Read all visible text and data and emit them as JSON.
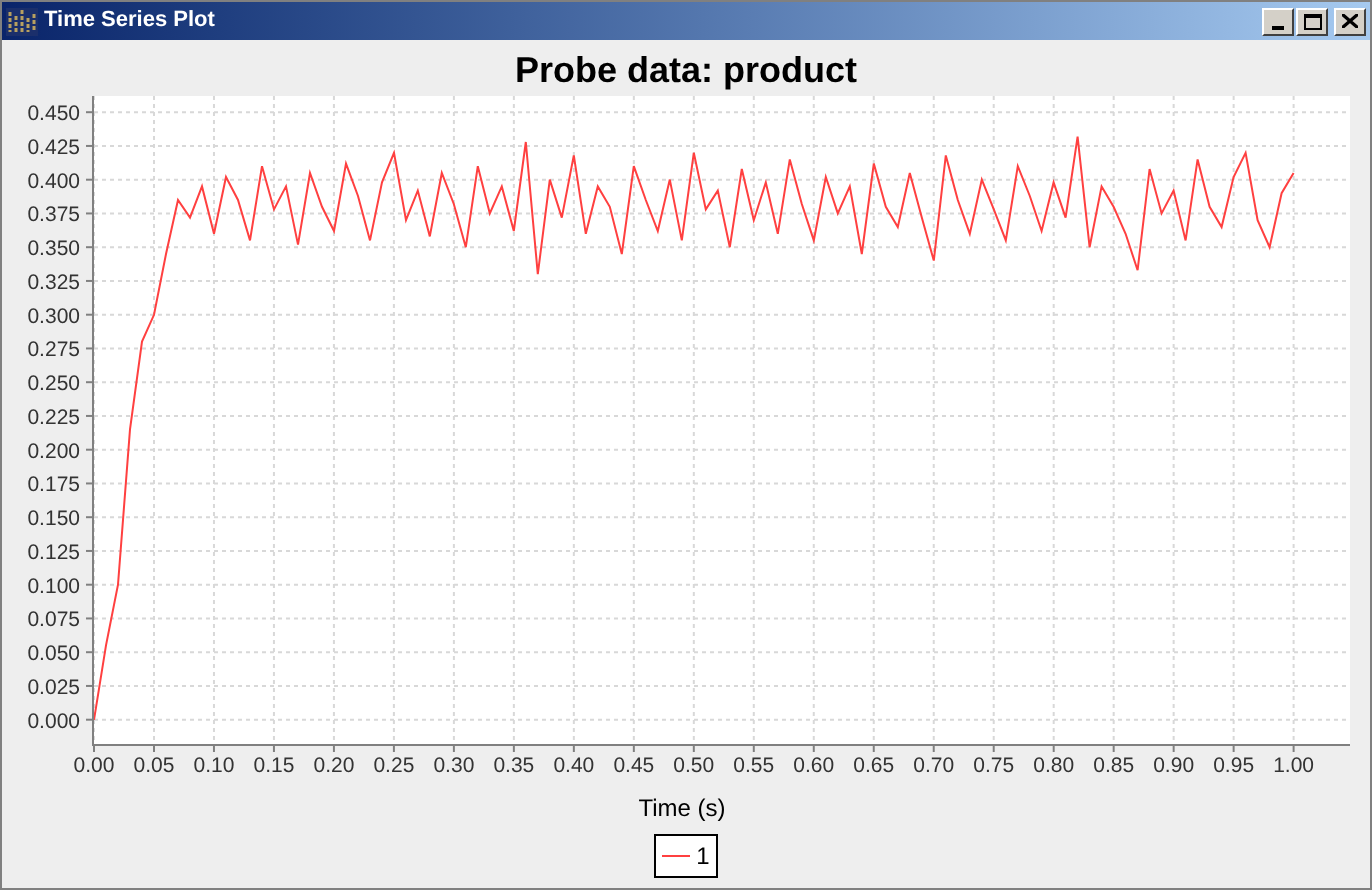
{
  "window": {
    "title": "Time Series Plot"
  },
  "chart": {
    "chart_data": {
      "type": "line",
      "grid": true,
      "title": "Probe data: product",
      "xlabel": "Time (s)",
      "x": [
        0,
        0.01,
        0.02,
        0.03,
        0.04,
        0.05,
        0.06,
        0.07,
        0.08,
        0.09,
        0.1,
        0.11,
        0.12,
        0.13,
        0.14,
        0.15,
        0.16,
        0.17,
        0.18,
        0.19,
        0.2,
        0.21,
        0.22,
        0.23,
        0.24,
        0.25,
        0.26,
        0.27,
        0.28,
        0.29,
        0.3,
        0.31,
        0.32,
        0.33,
        0.34,
        0.35,
        0.36,
        0.37,
        0.38,
        0.39,
        0.4,
        0.41,
        0.42,
        0.43,
        0.44,
        0.45,
        0.46,
        0.47,
        0.48,
        0.49,
        0.5,
        0.51,
        0.52,
        0.53,
        0.54,
        0.55,
        0.56,
        0.57,
        0.58,
        0.59,
        0.6,
        0.61,
        0.62,
        0.63,
        0.64,
        0.65,
        0.66,
        0.67,
        0.68,
        0.69,
        0.7,
        0.71,
        0.72,
        0.73,
        0.74,
        0.75,
        0.76,
        0.77,
        0.78,
        0.79,
        0.8,
        0.81,
        0.82,
        0.83,
        0.84,
        0.85,
        0.86,
        0.87,
        0.88,
        0.89,
        0.9,
        0.91,
        0.92,
        0.93,
        0.94,
        0.95,
        0.96,
        0.97,
        0.98,
        0.99,
        1
      ],
      "series": [
        {
          "name": "1",
          "color": "#ff4040",
          "values": [
            0,
            0.055,
            0.1,
            0.215,
            0.28,
            0.3,
            0.345,
            0.385,
            0.372,
            0.395,
            0.36,
            0.402,
            0.385,
            0.355,
            0.41,
            0.378,
            0.395,
            0.352,
            0.405,
            0.38,
            0.362,
            0.412,
            0.388,
            0.355,
            0.398,
            0.42,
            0.37,
            0.392,
            0.358,
            0.405,
            0.382,
            0.35,
            0.41,
            0.375,
            0.395,
            0.362,
            0.428,
            0.33,
            0.4,
            0.372,
            0.418,
            0.36,
            0.395,
            0.38,
            0.345,
            0.41,
            0.385,
            0.362,
            0.4,
            0.355,
            0.42,
            0.378,
            0.392,
            0.35,
            0.408,
            0.37,
            0.398,
            0.36,
            0.415,
            0.382,
            0.355,
            0.402,
            0.375,
            0.395,
            0.345,
            0.412,
            0.38,
            0.365,
            0.405,
            0.372,
            0.34,
            0.418,
            0.385,
            0.36,
            0.4,
            0.378,
            0.355,
            0.41,
            0.388,
            0.362,
            0.398,
            0.372,
            0.432,
            0.35,
            0.395,
            0.38,
            0.36,
            0.333,
            0.408,
            0.375,
            0.392,
            0.355,
            0.415,
            0.38,
            0.365,
            0.402,
            0.42,
            0.37,
            0.35,
            0.39,
            0.405
          ]
        }
      ],
      "xlim": [
        0,
        1.047
      ],
      "ylim": [
        -0.018,
        0.462
      ],
      "xticks": [
        {
          "value": 0,
          "label": "0.00"
        },
        {
          "value": 0.05,
          "label": "0.05"
        },
        {
          "value": 0.1,
          "label": "0.10"
        },
        {
          "value": 0.15,
          "label": "0.15"
        },
        {
          "value": 0.2,
          "label": "0.20"
        },
        {
          "value": 0.25,
          "label": "0.25"
        },
        {
          "value": 0.3,
          "label": "0.30"
        },
        {
          "value": 0.35,
          "label": "0.35"
        },
        {
          "value": 0.4,
          "label": "0.40"
        },
        {
          "value": 0.45,
          "label": "0.45"
        },
        {
          "value": 0.5,
          "label": "0.50"
        },
        {
          "value": 0.55,
          "label": "0.55"
        },
        {
          "value": 0.6,
          "label": "0.60"
        },
        {
          "value": 0.65,
          "label": "0.65"
        },
        {
          "value": 0.7,
          "label": "0.70"
        },
        {
          "value": 0.75,
          "label": "0.75"
        },
        {
          "value": 0.8,
          "label": "0.80"
        },
        {
          "value": 0.85,
          "label": "0.85"
        },
        {
          "value": 0.9,
          "label": "0.90"
        },
        {
          "value": 0.95,
          "label": "0.95"
        },
        {
          "value": 1,
          "label": "1.00"
        }
      ],
      "yticks": [
        {
          "value": 0,
          "label": "0.000"
        },
        {
          "value": 0.025,
          "label": "0.025"
        },
        {
          "value": 0.05,
          "label": "0.050"
        },
        {
          "value": 0.075,
          "label": "0.075"
        },
        {
          "value": 0.1,
          "label": "0.100"
        },
        {
          "value": 0.125,
          "label": "0.125"
        },
        {
          "value": 0.15,
          "label": "0.150"
        },
        {
          "value": 0.175,
          "label": "0.175"
        },
        {
          "value": 0.2,
          "label": "0.200"
        },
        {
          "value": 0.225,
          "label": "0.225"
        },
        {
          "value": 0.25,
          "label": "0.250"
        },
        {
          "value": 0.275,
          "label": "0.275"
        },
        {
          "value": 0.3,
          "label": "0.300"
        },
        {
          "value": 0.325,
          "label": "0.325"
        },
        {
          "value": 0.35,
          "label": "0.350"
        },
        {
          "value": 0.375,
          "label": "0.375"
        },
        {
          "value": 0.4,
          "label": "0.400"
        },
        {
          "value": 0.425,
          "label": "0.425"
        },
        {
          "value": 0.45,
          "label": "0.450"
        }
      ]
    }
  }
}
